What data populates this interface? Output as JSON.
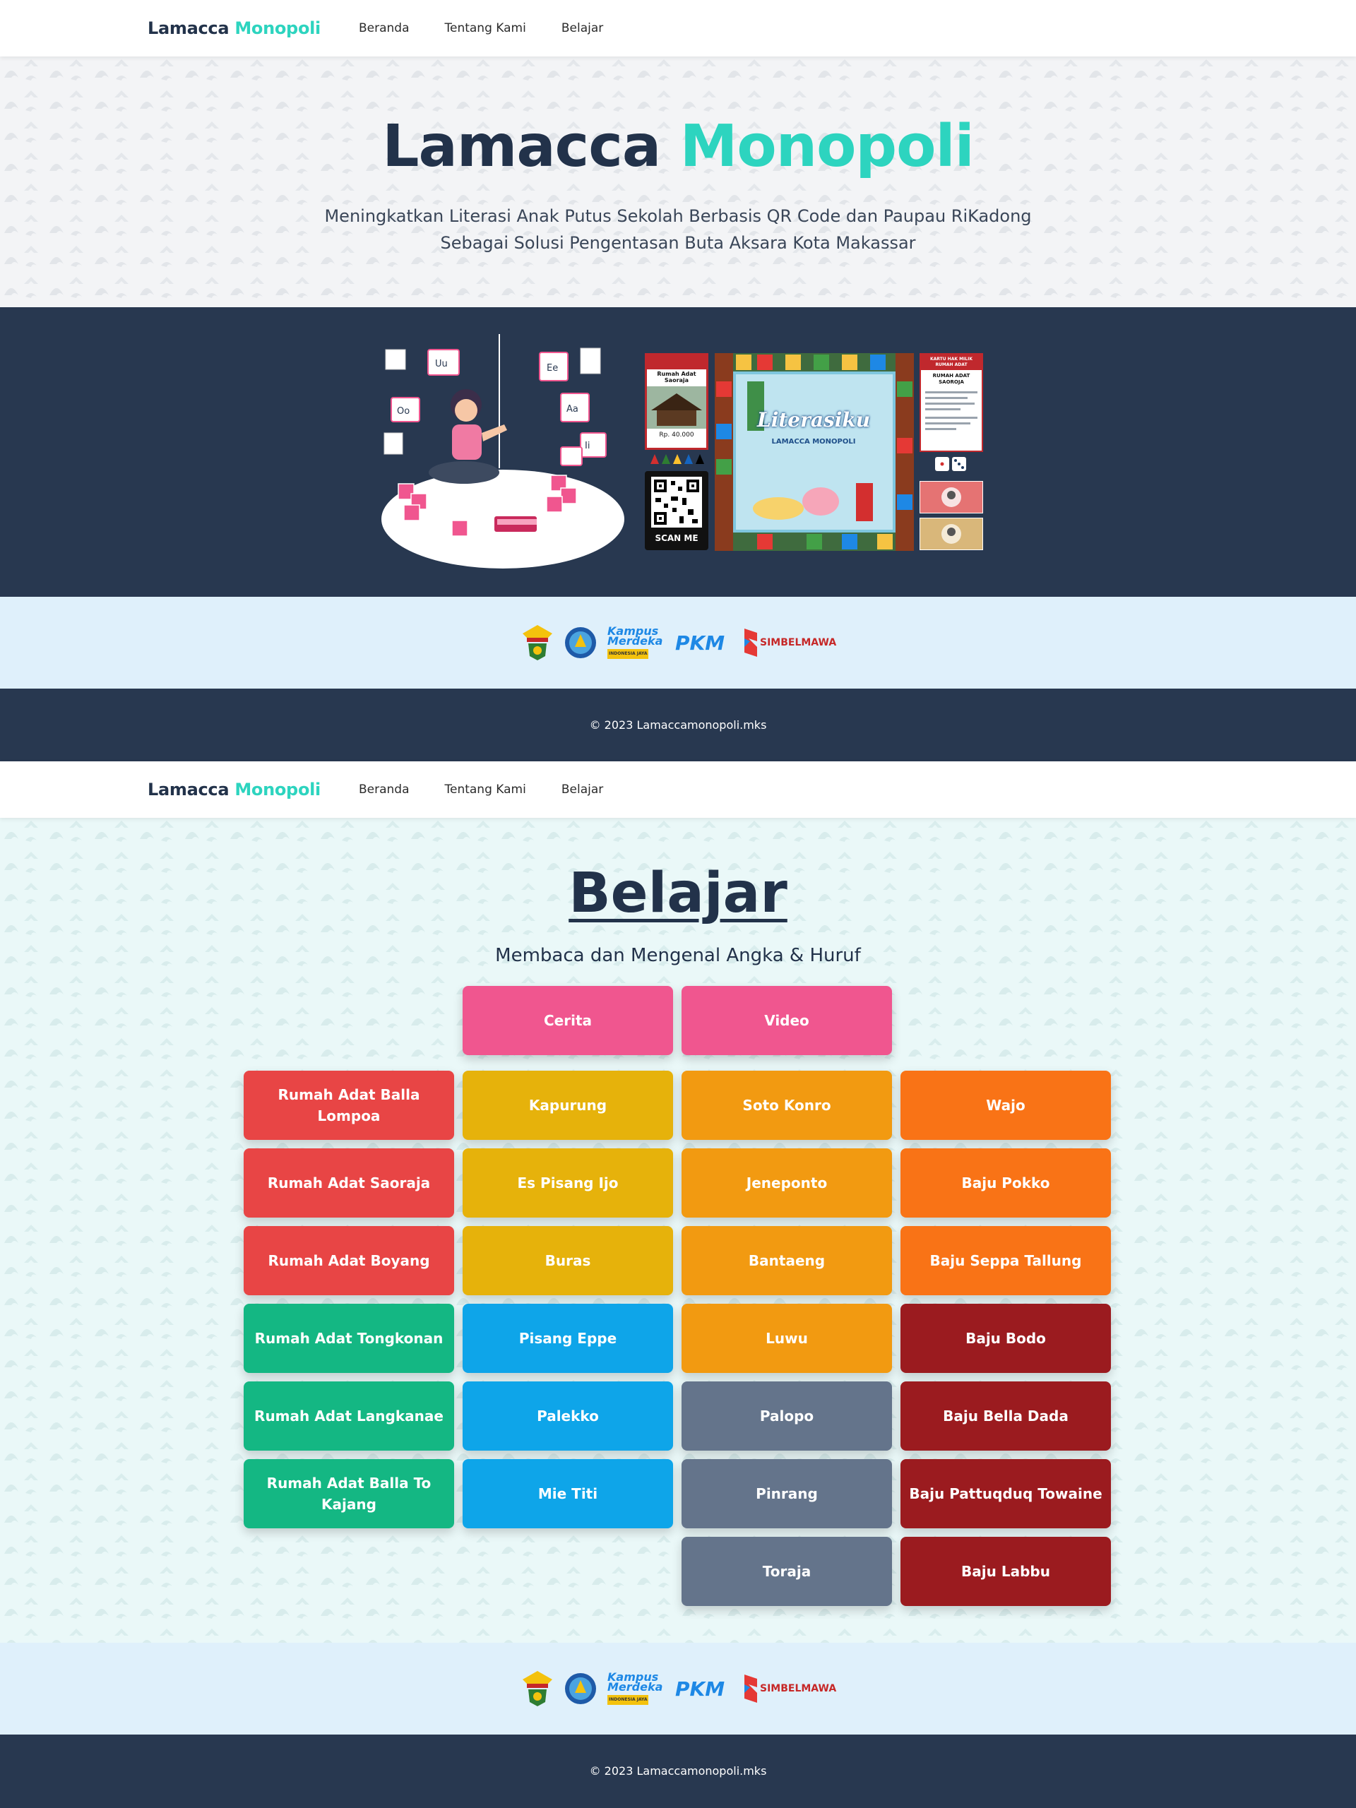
{
  "nav": {
    "brand_dark": "Lamacca",
    "brand_accent": "Monopoli",
    "links": [
      "Beranda",
      "Tentang Kami",
      "Belajar"
    ]
  },
  "hero": {
    "title_dark": "Lamacca",
    "title_accent": "Monopoli",
    "subtitle_line1": "Meningkatkan Literasi Anak Putus Sekolah Berbasis QR Code dan Paupau RiKadong",
    "subtitle_line2": "Sebagai Solusi Pengentasan Buta Aksara Kota Makassar"
  },
  "illustration": {
    "card_title": "Rumah Adat Saoraja",
    "card_price": "Rp. 40.000",
    "scan_label": "SCAN ME",
    "board_logo": "Literasiku",
    "board_tag": "LAMACCA MONOPOLI",
    "deed_header": "KARTU HAK MILIK RUMAH ADAT",
    "deed_title": "RUMAH ADAT SAOROJA"
  },
  "sponsors": [
    {
      "name": "Unhas emblem",
      "icon": "university-emblem-icon"
    },
    {
      "name": "Tut Wuri Handayani",
      "icon": "tut-wuri-icon"
    },
    {
      "name": "Kampus Merdeka",
      "icon": "kampus-merdeka-logo"
    },
    {
      "name": "PKM",
      "icon": "pkm-logo"
    },
    {
      "name": "SIMBELMAWA",
      "icon": "simbelmawa-logo"
    }
  ],
  "sponsor_texts": {
    "kampus_1": "Kampus",
    "kampus_2": "Merdeka",
    "kampus_3": "INDONESIA JAYA",
    "pkm": "PKM",
    "simbelmawa": "SIMBELMAWA"
  },
  "footer": {
    "copyright": "© 2023 Lamaccamonopoli.mks"
  },
  "belajar": {
    "title": "Belajar",
    "subtitle": "Membaca dan Mengenal Angka & Huruf",
    "top_buttons": [
      "Cerita",
      "Video"
    ],
    "columns": [
      [
        "Rumah Adat Balla Lompoa",
        "Rumah Adat Saoraja",
        "Rumah Adat Boyang",
        "Rumah Adat Tongkonan",
        "Rumah Adat Langkanae",
        "Rumah Adat Balla To Kajang"
      ],
      [
        "Kapurung",
        "Es Pisang Ijo",
        "Buras",
        "Pisang Eppe",
        "Palekko",
        "Mie Titi"
      ],
      [
        "Soto Konro",
        "Jeneponto",
        "Bantaeng",
        "Luwu",
        "Palopo",
        "Pinrang",
        "Toraja"
      ],
      [
        "Wajo",
        "Baju Pokko",
        "Baju Seppa Tallung",
        "Baju Bodo",
        "Baju Bella Dada",
        "Baju Pattuqduq Towaine",
        "Baju Labbu"
      ]
    ]
  },
  "colors": {
    "navy": "#283850",
    "teal": "#2dd4bf",
    "pink": "#f0568f",
    "red": "#e84545",
    "green": "#14b783",
    "yellow": "#e6b20b",
    "sky": "#0ea5e9",
    "amber": "#f29a11",
    "orange": "#f97316",
    "slate": "#64748b",
    "maroon": "#9b1b1f"
  }
}
